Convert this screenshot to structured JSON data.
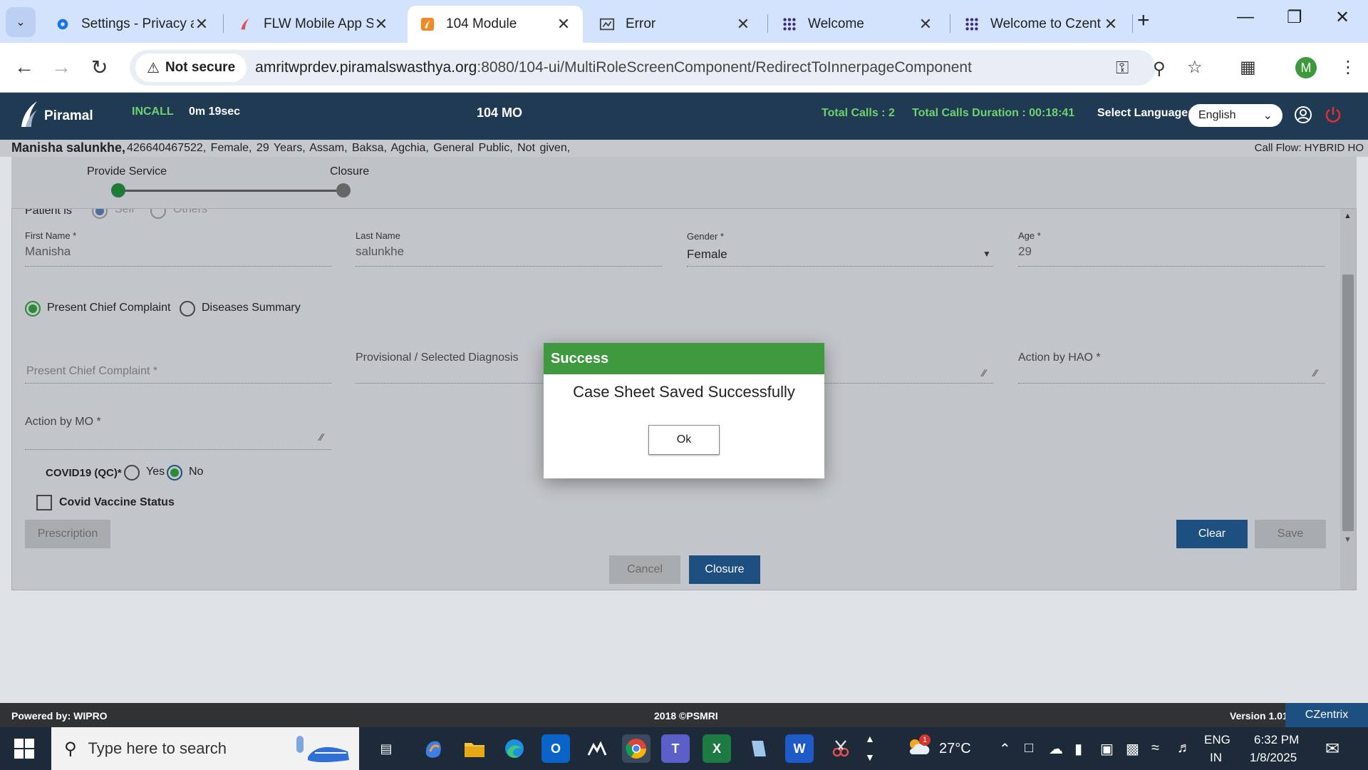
{
  "browser": {
    "tabs": [
      {
        "title": "Settings - Privacy a",
        "icon": "gear-icon"
      },
      {
        "title": "FLW Mobile App S",
        "icon": "piramal-icon"
      },
      {
        "title": "104 Module",
        "icon": "module-icon"
      },
      {
        "title": "Error",
        "icon": "error-page-icon"
      },
      {
        "title": "Welcome",
        "icon": "dots-grid-icon"
      },
      {
        "title": "Welcome to Czent",
        "icon": "dots-grid-icon"
      }
    ],
    "not_secure": "Not secure",
    "url_host": "amritwprdev.piramalswasthya.org",
    "url_path": ":8080/104-ui/MultiRoleScreenComponent/RedirectToInnerpageComponent",
    "profile_initial": "M"
  },
  "app": {
    "logo_text": "Piramal",
    "call_status": "INCALL",
    "call_duration": "0m 19sec",
    "module_name": "104 MO",
    "total_calls": "Total Calls : 2",
    "total_duration": "Total Calls Duration : 00:18:41",
    "language_label": "Select Language:",
    "language_value": "English"
  },
  "patient": {
    "name": "Manisha salunkhe,",
    "details": "426640467522,   Female,   29 Years,   Assam,   Baksa,   Agchia,   General Public,   Not given,",
    "call_flow": "Call Flow: HYBRID HO"
  },
  "stepper": {
    "steps": [
      "Provide Service",
      "Closure"
    ]
  },
  "form": {
    "patient_is_label": "Patient is",
    "patient_is_options": [
      "Self",
      "Others"
    ],
    "first_name_label": "First Name *",
    "first_name": "Manisha",
    "last_name_label": "Last Name",
    "last_name": "salunkhe",
    "gender_label": "Gender *",
    "gender": "Female",
    "age_label": "Age *",
    "age": "29",
    "complaint_options": [
      "Present Chief Complaint",
      "Diseases Summary"
    ],
    "present_chief_complaint_placeholder": "Present Chief Complaint *",
    "provisional_diagnosis_label": "Provisional / Selected Diagnosis",
    "action_hao_label": "Action by HAO *",
    "action_mo_label": "Action by MO *",
    "covid_label": "COVID19 (QC)*",
    "covid_yes": "Yes",
    "covid_no": "No",
    "vaccine_label": "Covid Vaccine Status",
    "prescription_button": "Prescription",
    "clear_button": "Clear",
    "save_button": "Save",
    "cancel_button": "Cancel",
    "closure_button": "Closure"
  },
  "modal": {
    "title": "Success",
    "message": "Case Sheet Saved Successfully",
    "ok_label": "Ok"
  },
  "footer": {
    "powered_by": "Powered by: WIPRO",
    "copyright": "2018 ©PSMRI",
    "version": "Version 1.01",
    "vendor": "CZentrix"
  },
  "taskbar": {
    "search_placeholder": "Type here to search",
    "weather": "27°C",
    "weather_badge": "1",
    "language": "ENG",
    "region": "IN",
    "time": "6:32 PM",
    "date": "1/8/2025"
  },
  "colors": {
    "app_header": "#1f3a52",
    "accent_green": "#3f9a3f",
    "button_blue": "#1d4f80"
  }
}
